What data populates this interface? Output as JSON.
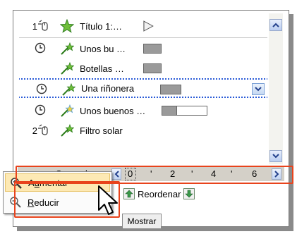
{
  "list": {
    "rows": [
      {
        "num": "1",
        "label": "Título 1:…"
      },
      {
        "num": "",
        "label": "Unos bu …"
      },
      {
        "num": "",
        "label": "Botellas …"
      },
      {
        "num": "",
        "label": "Una riñonera"
      },
      {
        "num": "",
        "label": "Unos buenos …"
      },
      {
        "num": "2",
        "label": "Filtro solar"
      }
    ]
  },
  "timeline": {
    "units_label": "Segundos",
    "scale": [
      "0",
      "2",
      "4",
      "6"
    ]
  },
  "reorder": {
    "label": "Reordenar"
  },
  "menu": {
    "items": [
      {
        "label_pre": "A",
        "mnemonic": "u",
        "label_post": "mentar"
      },
      {
        "label_pre": "",
        "mnemonic": "R",
        "label_post": "educir"
      }
    ]
  },
  "bottom": {
    "show_button": "Mostrar"
  },
  "colors": {
    "highlight": "#e8431c",
    "selection": "#2a5bd7",
    "menu_hover": "#fde9b4"
  }
}
